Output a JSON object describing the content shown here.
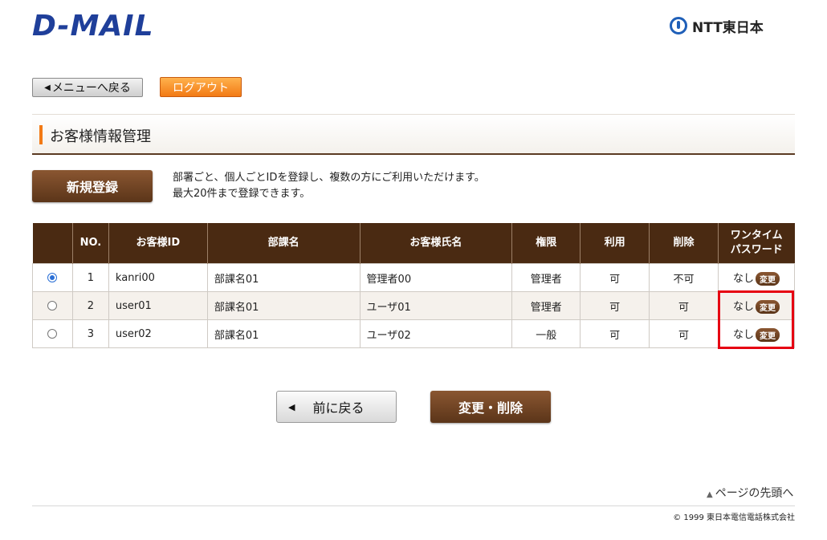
{
  "header": {
    "logo_text": "D-MAIL",
    "ntt_text": "NTT東日本"
  },
  "nav": {
    "menu_back_icon": "◀",
    "menu_back_label": "メニューへ戻る",
    "logout_label": "ログアウト"
  },
  "section": {
    "title": "お客様情報管理"
  },
  "actions": {
    "new_register_label": "新規登録",
    "description_line1": "部署ごと、個人ごとIDを登録し、複数の方にご利用いただけます。",
    "description_line2": "最大20件まで登録できます。"
  },
  "table": {
    "headers": {
      "no": "NO.",
      "customer_id": "お客様ID",
      "department": "部課名",
      "customer_name": "お客様氏名",
      "authority": "権限",
      "usage": "利用",
      "delete": "削除",
      "otp_line1": "ワンタイム",
      "otp_line2": "パスワード"
    },
    "rows": [
      {
        "selected": true,
        "no": "1",
        "customer_id": "kanri00",
        "department": "部課名01",
        "customer_name": "管理者00",
        "authority": "管理者",
        "usage": "可",
        "delete": "不可",
        "otp": "なし",
        "otp_button": "変更"
      },
      {
        "selected": false,
        "no": "2",
        "customer_id": "user01",
        "department": "部課名01",
        "customer_name": "ユーザ01",
        "authority": "管理者",
        "usage": "可",
        "delete": "可",
        "otp": "なし",
        "otp_button": "変更"
      },
      {
        "selected": false,
        "no": "3",
        "customer_id": "user02",
        "department": "部課名01",
        "customer_name": "ユーザ02",
        "authority": "一般",
        "usage": "可",
        "delete": "可",
        "otp": "なし",
        "otp_button": "変更"
      }
    ]
  },
  "footer_buttons": {
    "back_icon": "◀",
    "back_label": "前に戻る",
    "update_label": "変更・削除"
  },
  "footer": {
    "page_top_icon": "▲",
    "page_top_label": "ページの先頭へ",
    "copyright": "© 1999 東日本電信電話株式会社"
  },
  "colors": {
    "brand_blue": "#1f3f9a",
    "header_brown": "#4a2a12",
    "accent_orange": "#f27a15",
    "highlight_red": "#e60012"
  }
}
